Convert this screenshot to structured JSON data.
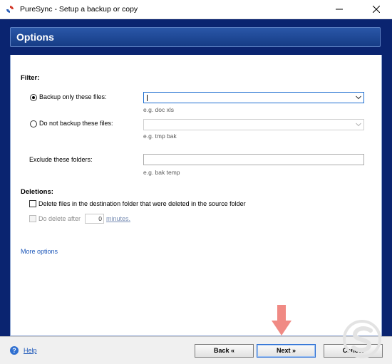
{
  "window": {
    "title": "PureSync - Setup a backup or copy"
  },
  "header": {
    "title": "Options"
  },
  "filter": {
    "section_label": "Filter:",
    "backup_only": {
      "label": "Backup only these files:",
      "selected": true,
      "value": "",
      "hint": "e.g. doc xls"
    },
    "do_not_backup": {
      "label": "Do not backup these files:",
      "selected": false,
      "value": "",
      "hint": "e.g. tmp bak"
    },
    "exclude_folders": {
      "label": "Exclude these folders:",
      "value": "",
      "hint": "e.g. bak temp"
    }
  },
  "deletions": {
    "section_label": "Deletions:",
    "delete_files": {
      "label": "Delete files in the destination folder that were deleted in the source folder",
      "checked": false
    },
    "do_delete_after": {
      "label": "Do delete after",
      "checked": false,
      "enabled": false,
      "minutes_value": "0",
      "unit_label": "minutes."
    }
  },
  "more_options_link": "More options",
  "footer": {
    "help_label": "Help",
    "help_icon_glyph": "?",
    "back_label": "Back «",
    "next_label": "Next »",
    "cancel_label": "Cancel"
  },
  "icons": {
    "app": "puresync-app-icon",
    "minimize": "minimize-icon",
    "close": "close-icon",
    "dropdown": "chevron-down-icon",
    "help": "help-icon",
    "pointer": "red-down-arrow-icon",
    "watermark": "watermark-logo-icon"
  },
  "colors": {
    "header_band": "#0a2470",
    "options_bar": "#1e4a9a",
    "link": "#1a55b8",
    "focus_border": "#1f6fd1",
    "pointer_arrow": "#f08a84"
  }
}
